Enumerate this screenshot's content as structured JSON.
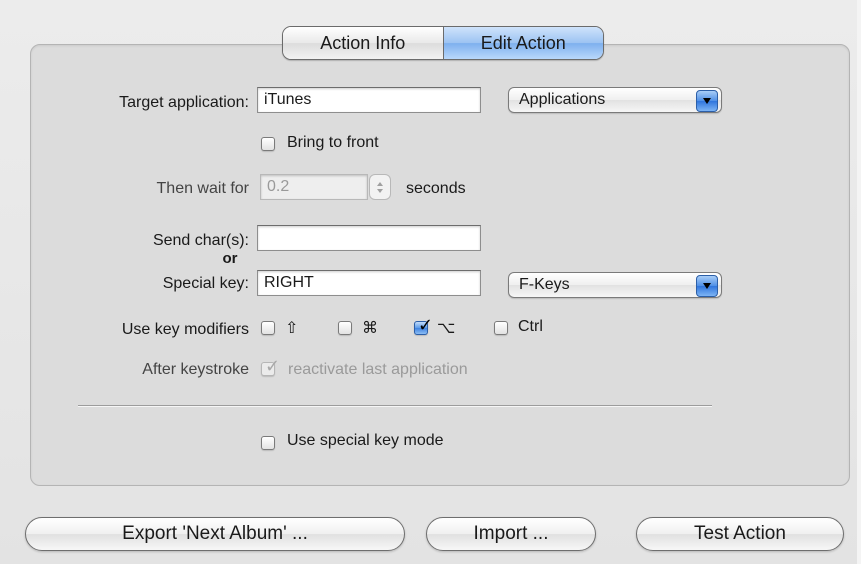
{
  "tabs": [
    {
      "label": "Action Info",
      "active": false
    },
    {
      "label": "Edit Action",
      "active": true
    }
  ],
  "target_application": {
    "label": "Target application:",
    "value": "iTunes",
    "popup_label": "Applications"
  },
  "bring_to_front": {
    "label": "Bring to front",
    "checked": false
  },
  "wait": {
    "label": "Then wait for",
    "value": "0.2",
    "unit": "seconds",
    "enabled": false
  },
  "send_chars": {
    "label": "Send char(s):",
    "value": ""
  },
  "or_label": "or",
  "special_key": {
    "label": "Special key:",
    "value": "RIGHT",
    "popup_label": "F-Keys"
  },
  "modifiers": {
    "label": "Use key modifiers",
    "items": [
      {
        "symbol": "⇧",
        "checked": false
      },
      {
        "symbol": "⌘",
        "checked": true,
        "note": "unchecked in image"
      },
      {
        "symbol": "⌥",
        "checked": true
      },
      {
        "symbol": "Ctrl",
        "checked": false
      }
    ]
  },
  "after_keystroke": {
    "label": "After keystroke",
    "checkbox_label": "reactivate last application",
    "checked": true,
    "enabled": false
  },
  "special_key_mode": {
    "label": "Use special key mode",
    "checked": false
  },
  "buttons": {
    "export": "Export 'Next Album' ...",
    "import": "Import ...",
    "test": "Test Action"
  },
  "colors": {
    "accent": "#3f82e0",
    "window_bg": "#e8e8e8",
    "panel_bg": "#dcdcdc"
  }
}
